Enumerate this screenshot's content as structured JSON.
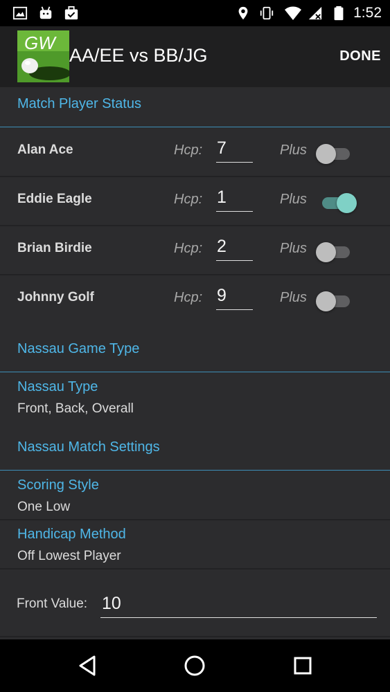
{
  "status_bar": {
    "time": "1:52",
    "left_icons": [
      "image-icon",
      "android-icon",
      "briefcase-check-icon"
    ],
    "right_icons": [
      "location-icon",
      "vibrate-icon",
      "wifi-icon",
      "signal-off-icon",
      "battery-icon"
    ]
  },
  "app_bar": {
    "logo_text": "GW",
    "title": "AA/EE vs BB/JG",
    "done_label": "DONE"
  },
  "sections": {
    "match_player_status": "Match Player Status",
    "nassau_game_type": "Nassau Game Type",
    "nassau_match_settings": "Nassau Match Settings"
  },
  "players": [
    {
      "name": "Alan Ace",
      "hcp_label": "Hcp:",
      "hcp": "7",
      "plus_label": "Plus",
      "plus_on": false
    },
    {
      "name": "Eddie Eagle",
      "hcp_label": "Hcp:",
      "hcp": "1",
      "plus_label": "Plus",
      "plus_on": true
    },
    {
      "name": "Brian Birdie",
      "hcp_label": "Hcp:",
      "hcp": "2",
      "plus_label": "Plus",
      "plus_on": false
    },
    {
      "name": "Johnny Golf",
      "hcp_label": "Hcp:",
      "hcp": "9",
      "plus_label": "Plus",
      "plus_on": false
    }
  ],
  "nassau_type": {
    "title": "Nassau Type",
    "value": "Front, Back, Overall"
  },
  "scoring_style": {
    "title": "Scoring Style",
    "value": "One Low"
  },
  "handicap_method": {
    "title": "Handicap Method",
    "value": "Off Lowest Player"
  },
  "front_value": {
    "label": "Front Value:",
    "value": "10"
  },
  "colors": {
    "accent": "#4fb7e8",
    "background": "#2c2c2e",
    "app_bar": "#1f1f20",
    "toggle_on": "#7fd1c6"
  }
}
